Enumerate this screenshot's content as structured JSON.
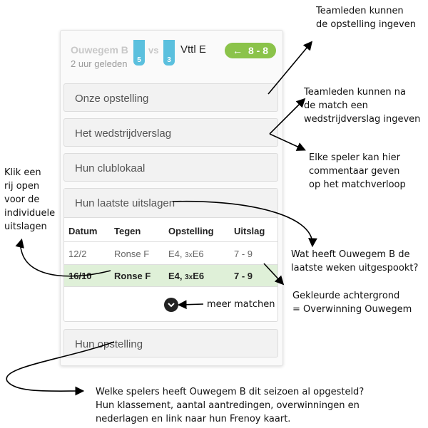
{
  "match": {
    "home_team": "Ouwegem B",
    "home_badge": "5",
    "vs": "vs",
    "away_badge": "3",
    "away_team": "Vttl E",
    "time": "2 uur geleden",
    "score_arrow": "←",
    "score": "8 - 8"
  },
  "panels": {
    "our_lineup": "Onze opstelling",
    "report": "Het wedstrijdverslag",
    "club": "Hun clublokaal",
    "results": "Hun laatste uitslagen",
    "their_lineup": "Hun opstelling"
  },
  "results_table": {
    "headers": [
      "Datum",
      "Tegen",
      "Opstelling",
      "Uitslag"
    ],
    "rows": [
      {
        "date": "12/2",
        "opponent": "Ronse F",
        "lineup_a": "E4, ",
        "lineup_b": "3x",
        "lineup_c": "E6",
        "result": "7 - 9",
        "win": false
      },
      {
        "date": "16/10",
        "opponent": "Ronse F",
        "lineup_a": "E4, ",
        "lineup_b": "3x",
        "lineup_c": "E6",
        "result": "7 - 9",
        "win": true
      }
    ]
  },
  "annotations": {
    "a1_l1": "Teamleden kunnen",
    "a1_l2": "de opstelling ingeven",
    "a2_l1": "Teamleden kunnen na",
    "a2_l2": "de match een",
    "a2_l3": "wedstrijdverslag ingeven",
    "a3_l1": "Elke speler kan hier",
    "a3_l2": "commentaar geven",
    "a3_l3": "op het matchverloop",
    "a4_l1": "Klik een",
    "a4_l2": "rij open",
    "a4_l3": "voor de",
    "a4_l4": "individuele",
    "a4_l5": "uitslagen",
    "a5_l1": "Wat heeft Ouwegem B de",
    "a5_l2": "laatste weken uitgespookt?",
    "a6_l1": "Gekleurde achtergrond",
    "a6_l2": "= Overwinning Ouwegem",
    "a7": "meer matchen",
    "a8_l1": "Welke spelers heeft Ouwegem B dit seizoen al opgesteld?",
    "a8_l2": "Hun klassement, aantal aantredingen, overwinningen en",
    "a8_l3": "nederlagen en link naar hun Frenoy kaart."
  },
  "colors": {
    "win_bg": "#dff0d8",
    "score_bg": "#8bc34a",
    "badge_bg": "#5bc0de"
  }
}
